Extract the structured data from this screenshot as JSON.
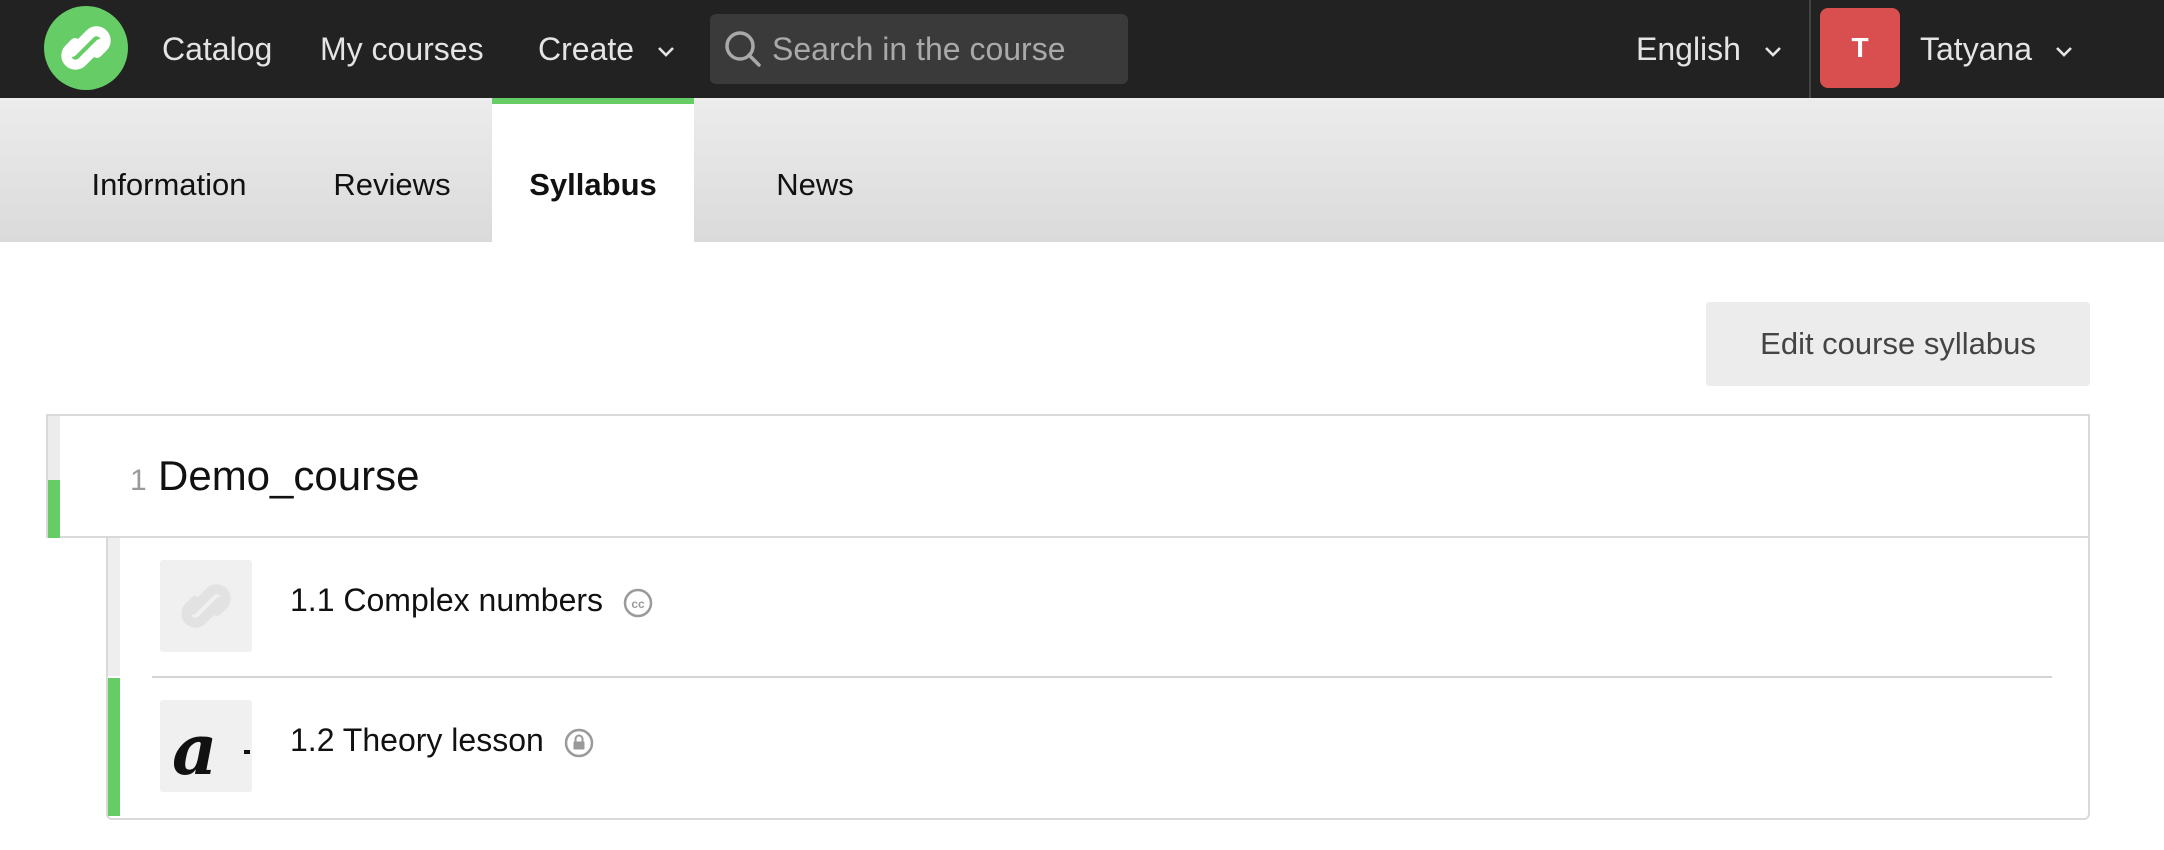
{
  "topnav": {
    "logo_icon": "stepik-logo-icon",
    "brand_color": "#66cc66",
    "catalog_label": "Catalog",
    "my_courses_label": "My courses",
    "create_label": "Create",
    "search_placeholder": "Search in the course",
    "language_label": "English",
    "avatar_initial": "T",
    "avatar_color": "#d94f4f",
    "user_name": "Tatyana"
  },
  "tabs": [
    {
      "label": "Information",
      "active": false
    },
    {
      "label": "Reviews",
      "active": false
    },
    {
      "label": "Syllabus",
      "active": true
    },
    {
      "label": "News",
      "active": false
    }
  ],
  "edit_button_label": "Edit course syllabus",
  "section": {
    "number": "1",
    "title": "Demo_course",
    "lessons": [
      {
        "title": "1.1 Complex numbers",
        "badge_icon": "creative-commons-icon",
        "thumb_icon": "stepik-logo-icon"
      },
      {
        "title": "1.2 Theory lesson",
        "badge_icon": "lock-icon",
        "thumb_icon": "letter-a-icon"
      }
    ]
  }
}
